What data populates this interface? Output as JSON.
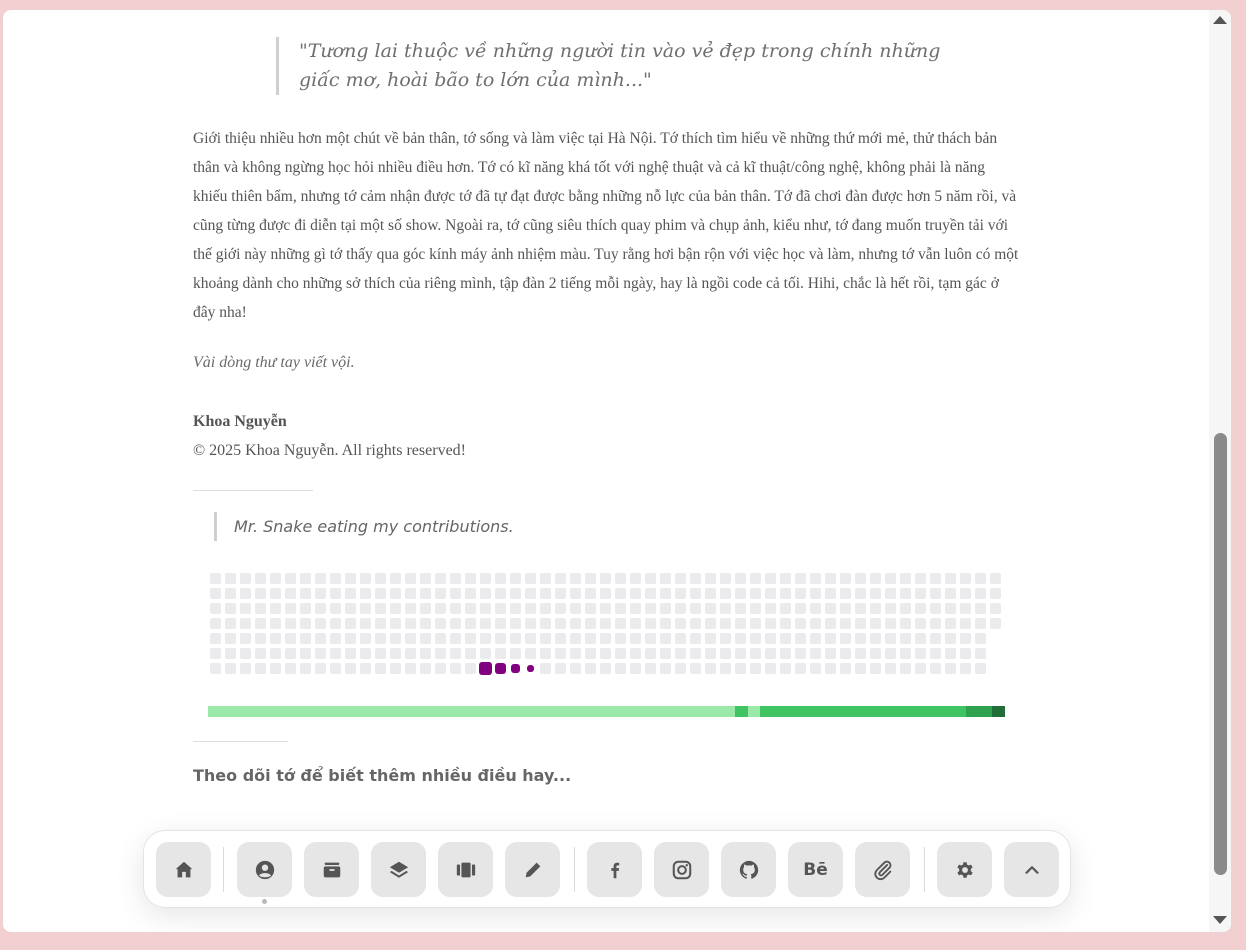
{
  "quote_top": "\"Tương lai thuộc về những người tin vào vẻ đẹp trong chính những giấc mơ, hoài bão to lớn của mình...\"",
  "intro": "Giới thiệu nhiều hơn một chút về bản thân, tớ sống và làm việc tại Hà Nội. Tớ thích tìm hiểu về những thứ mới mẻ, thử thách bản thân và không ngừng học hỏi nhiều điều hơn. Tớ có kĩ năng khá tốt với nghệ thuật và cả kĩ thuật/công nghệ, không phải là năng khiếu thiên bẩm, nhưng tớ cảm nhận được tớ đã tự đạt được bằng những nỗ lực của bản thân. Tớ đã chơi đàn được hơn 5 năm rồi, và cũng từng được đi diễn tại một số show. Ngoài ra, tớ cũng siêu thích quay phim và chụp ảnh, kiểu như, tớ đang muốn truyền tải với thế giới này những gì tớ thấy qua góc kính máy ảnh nhiệm màu. Tuy rằng hơi bận rộn với việc học và làm, nhưng tớ vẫn luôn có một khoảng dành cho những sở thích của riêng mình, tập đàn 2 tiếng mỗi ngày, hay là ngồi code cả tối. Hihi, chắc là hết rồi, tạm gác ở đây nha!",
  "note": "Vài dòng thư tay viết vội.",
  "author": "Khoa Nguyễn",
  "copyright": "© 2025 Khoa Nguyễn. All rights reserved!",
  "snake_caption": "Mr. Snake eating my contributions.",
  "follow_text": "Theo dõi tớ để biết thêm nhiều điều hay...",
  "colors": {
    "grid_cell": "#ebebee",
    "snake": "#800080",
    "progress": [
      "#9be9a8",
      "#40c463",
      "#30a14e",
      "#216e39"
    ]
  },
  "dock": {
    "items": [
      {
        "name": "home-icon"
      },
      {
        "name": "profile-icon",
        "active": true
      },
      {
        "name": "archive-icon"
      },
      {
        "name": "layers-icon"
      },
      {
        "name": "gallery-icon"
      },
      {
        "name": "pencil-icon"
      },
      {
        "name": "facebook-icon",
        "label": "f"
      },
      {
        "name": "instagram-icon"
      },
      {
        "name": "github-icon"
      },
      {
        "name": "behance-icon",
        "label": "Bē"
      },
      {
        "name": "paperclip-icon"
      },
      {
        "name": "gear-icon"
      },
      {
        "name": "chevron-up-icon"
      }
    ]
  }
}
